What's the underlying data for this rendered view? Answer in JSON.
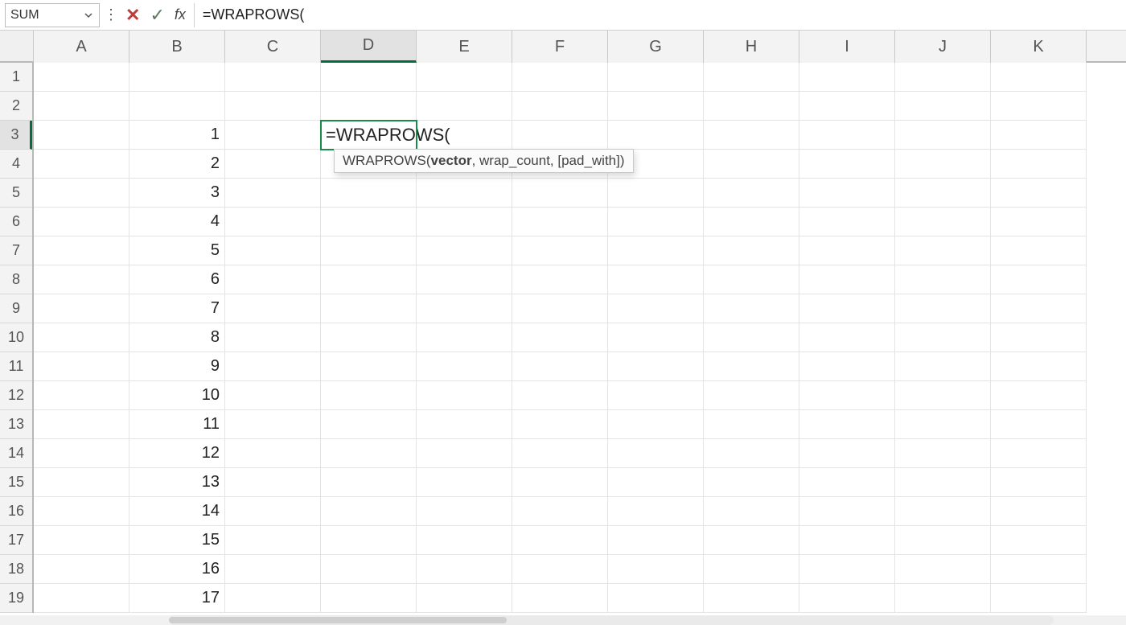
{
  "formula_bar": {
    "name_box": "SUM",
    "formula_text": "=WRAPROWS("
  },
  "columns": [
    "A",
    "B",
    "C",
    "D",
    "E",
    "F",
    "G",
    "H",
    "I",
    "J",
    "K"
  ],
  "active_column": "D",
  "rows": [
    1,
    2,
    3,
    4,
    5,
    6,
    7,
    8,
    9,
    10,
    11,
    12,
    13,
    14,
    15,
    16,
    17,
    18,
    19
  ],
  "active_row": 3,
  "col_b_values": {
    "3": "1",
    "4": "2",
    "5": "3",
    "6": "4",
    "7": "5",
    "8": "6",
    "9": "7",
    "10": "8",
    "11": "9",
    "12": "10",
    "13": "11",
    "14": "12",
    "15": "13",
    "16": "14",
    "17": "15",
    "18": "16",
    "19": "17"
  },
  "editing_cell": {
    "row": 3,
    "col": "D",
    "text": "=WRAPROWS("
  },
  "tooltip": {
    "fn": "WRAPROWS(",
    "arg_bold": "vector",
    "rest": ", wrap_count, [pad_with])"
  }
}
